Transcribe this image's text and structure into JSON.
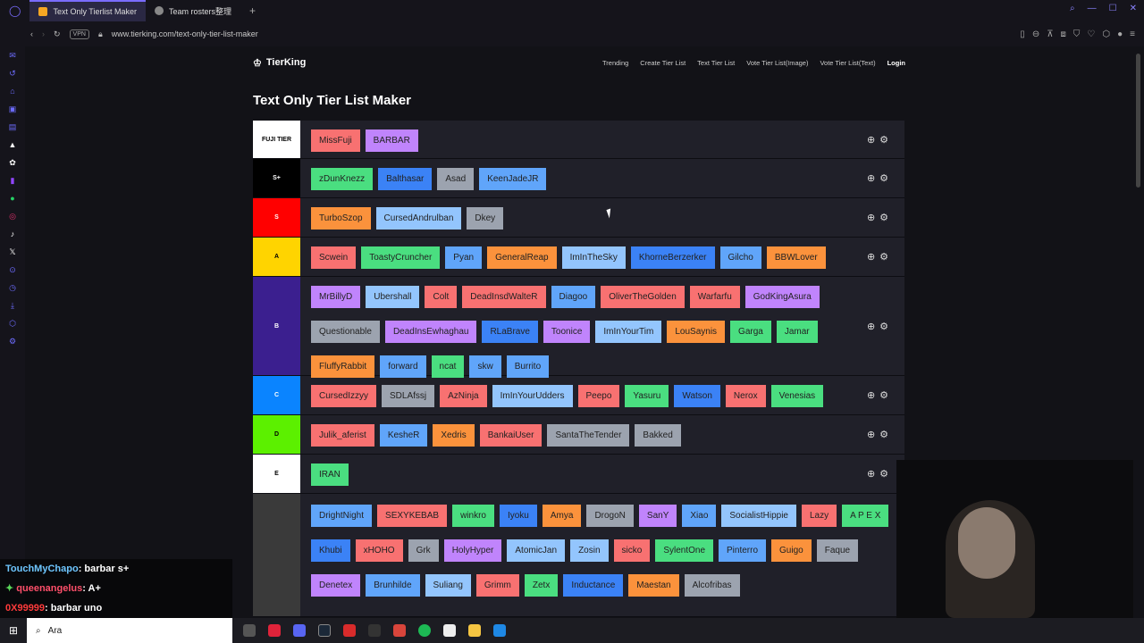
{
  "browser": {
    "tabs": [
      {
        "label": "Text Only Tierlist Maker",
        "active": true
      },
      {
        "label": "Team rosters整理",
        "active": false
      }
    ],
    "add_tab": "+",
    "vpn": "VPN",
    "url": "www.tierking.com/text-only-tier-list-maker"
  },
  "site": {
    "logo": "TierKing",
    "nav": [
      "Trending",
      "Create Tier List",
      "Text Tier List",
      "Vote Tier List(Image)",
      "Vote Tier List(Text)"
    ],
    "login": "Login",
    "title": "Text Only Tier List Maker"
  },
  "tiers": [
    {
      "label": "FUJI TIER",
      "color": "#ffffff",
      "labelColor": "#000000",
      "items": [
        {
          "t": "MissFuji",
          "c": "#f87171"
        },
        {
          "t": "BARBAR",
          "c": "#c084fc"
        }
      ]
    },
    {
      "label": "S+",
      "color": "#000000",
      "labelColor": "#ffffff",
      "items": [
        {
          "t": "zDunKnezz",
          "c": "#4ade80"
        },
        {
          "t": "Balthasar",
          "c": "#3b82f6"
        },
        {
          "t": "Asad",
          "c": "#9ca3af"
        },
        {
          "t": "KeenJadeJR",
          "c": "#60a5fa"
        }
      ]
    },
    {
      "label": "S",
      "color": "#ff0000",
      "labelColor": "#ffffff",
      "items": [
        {
          "t": "TurboSzop",
          "c": "#fb923c"
        },
        {
          "t": "CursedAndrulban",
          "c": "#93c5fd"
        },
        {
          "t": "Dkey",
          "c": "#9ca3af"
        }
      ]
    },
    {
      "label": "A",
      "color": "#ffd400",
      "labelColor": "#000000",
      "items": [
        {
          "t": "Scwein",
          "c": "#f87171"
        },
        {
          "t": "ToastyCruncher",
          "c": "#4ade80"
        },
        {
          "t": "Pyan",
          "c": "#60a5fa"
        },
        {
          "t": "GeneralReap",
          "c": "#fb923c"
        },
        {
          "t": "ImInTheSky",
          "c": "#93c5fd"
        },
        {
          "t": "KhorneBerzerker",
          "c": "#3b82f6"
        },
        {
          "t": "Gilcho",
          "c": "#60a5fa"
        },
        {
          "t": "BBWLover",
          "c": "#fb923c"
        }
      ]
    },
    {
      "label": "B",
      "color": "#3b1f8f",
      "labelColor": "#ffffff",
      "items": [
        {
          "t": "MrBillyD",
          "c": "#c084fc"
        },
        {
          "t": "Ubershall",
          "c": "#93c5fd"
        },
        {
          "t": "Colt",
          "c": "#f87171"
        },
        {
          "t": "DeadInsdWalteR",
          "c": "#f87171"
        },
        {
          "t": "Diagoo",
          "c": "#60a5fa"
        },
        {
          "t": "OliverTheGolden",
          "c": "#f87171"
        },
        {
          "t": "Warfarfu",
          "c": "#f87171"
        },
        {
          "t": "GodKingAsura",
          "c": "#c084fc"
        },
        {
          "t": "Questionable",
          "c": "#9ca3af"
        },
        {
          "t": "DeadInsEwhaghau",
          "c": "#c084fc"
        },
        {
          "t": "RLaBrave",
          "c": "#3b82f6"
        },
        {
          "t": "Toonice",
          "c": "#c084fc"
        },
        {
          "t": "ImInYourTim",
          "c": "#93c5fd"
        },
        {
          "t": "LouSaynis",
          "c": "#fb923c"
        },
        {
          "t": "Garga",
          "c": "#4ade80"
        },
        {
          "t": "Jamar",
          "c": "#4ade80"
        },
        {
          "t": "FluffyRabbit",
          "c": "#fb923c"
        },
        {
          "t": "forward",
          "c": "#60a5fa"
        },
        {
          "t": "ncat",
          "c": "#4ade80"
        },
        {
          "t": "skw",
          "c": "#60a5fa"
        },
        {
          "t": "Burrito",
          "c": "#60a5fa"
        }
      ]
    },
    {
      "label": "C",
      "color": "#0a84ff",
      "labelColor": "#ffffff",
      "items": [
        {
          "t": "CursedIzzyy",
          "c": "#f87171"
        },
        {
          "t": "SDLAfssj",
          "c": "#9ca3af"
        },
        {
          "t": "AzNinja",
          "c": "#f87171"
        },
        {
          "t": "ImInYourUdders",
          "c": "#93c5fd"
        },
        {
          "t": "Peepo",
          "c": "#f87171"
        },
        {
          "t": "Yasuru",
          "c": "#4ade80"
        },
        {
          "t": "Watson",
          "c": "#3b82f6"
        },
        {
          "t": "Nerox",
          "c": "#f87171"
        },
        {
          "t": "Venesias",
          "c": "#4ade80"
        }
      ]
    },
    {
      "label": "D",
      "color": "#5cf000",
      "labelColor": "#000000",
      "items": [
        {
          "t": "Julik_aferist",
          "c": "#f87171"
        },
        {
          "t": "KesheR",
          "c": "#60a5fa"
        },
        {
          "t": "Xedris",
          "c": "#fb923c"
        },
        {
          "t": "BankaiUser",
          "c": "#f87171"
        },
        {
          "t": "SantaTheTender",
          "c": "#9ca3af"
        },
        {
          "t": "Bakked",
          "c": "#9ca3af"
        }
      ]
    },
    {
      "label": "E",
      "color": "#ffffff",
      "labelColor": "#000000",
      "items": [
        {
          "t": "IRAN",
          "c": "#4ade80"
        }
      ]
    },
    {
      "label": "",
      "color": "#3a3a3a",
      "labelColor": "#ffffff",
      "pool": true,
      "items": [
        {
          "t": "DrightNight",
          "c": "#60a5fa"
        },
        {
          "t": "SEXYKEBAB",
          "c": "#f87171"
        },
        {
          "t": "winkro",
          "c": "#4ade80"
        },
        {
          "t": "Iyoku",
          "c": "#3b82f6"
        },
        {
          "t": "Amya",
          "c": "#fb923c"
        },
        {
          "t": "DrogoN",
          "c": "#9ca3af"
        },
        {
          "t": "SanY",
          "c": "#c084fc"
        },
        {
          "t": "Xiao",
          "c": "#60a5fa"
        },
        {
          "t": "SocialistHippie",
          "c": "#93c5fd"
        },
        {
          "t": "Lazy",
          "c": "#f87171"
        },
        {
          "t": "A P E X",
          "c": "#4ade80"
        },
        {
          "t": "Khubi",
          "c": "#3b82f6"
        },
        {
          "t": "xHOHO",
          "c": "#f87171"
        },
        {
          "t": "Grk",
          "c": "#9ca3af"
        },
        {
          "t": "HolyHyper",
          "c": "#c084fc"
        },
        {
          "t": "AtomicJan",
          "c": "#93c5fd"
        },
        {
          "t": "Zosin",
          "c": "#93c5fd"
        },
        {
          "t": "sicko",
          "c": "#f87171"
        },
        {
          "t": "SylentOne",
          "c": "#4ade80"
        },
        {
          "t": "Pinterro",
          "c": "#60a5fa"
        },
        {
          "t": "Guigo",
          "c": "#fb923c"
        },
        {
          "t": "Faque",
          "c": "#9ca3af"
        },
        {
          "t": "Denetex",
          "c": "#c084fc"
        },
        {
          "t": "Brunhilde",
          "c": "#60a5fa"
        },
        {
          "t": "Suliang",
          "c": "#93c5fd"
        },
        {
          "t": "Grimm",
          "c": "#f87171"
        },
        {
          "t": "Zetx",
          "c": "#4ade80"
        },
        {
          "t": "Inductance",
          "c": "#3b82f6"
        },
        {
          "t": "Maestan",
          "c": "#fb923c"
        },
        {
          "t": "Alcofribas",
          "c": "#9ca3af"
        }
      ]
    }
  ],
  "controls": {
    "add": "⊕",
    "settings": "⚙"
  },
  "chat": [
    {
      "user": "TouchMyChapo",
      "msg": ": barbar s+",
      "color": "#6ec6ff"
    },
    {
      "user": "queenangelus",
      "msg": ": A+",
      "color": "#ff4f6a"
    },
    {
      "user": "0X99999",
      "msg": ": barbar uno",
      "color": "#ff3b3b"
    }
  ],
  "taskbar": {
    "search_placeholder": "Ara"
  }
}
